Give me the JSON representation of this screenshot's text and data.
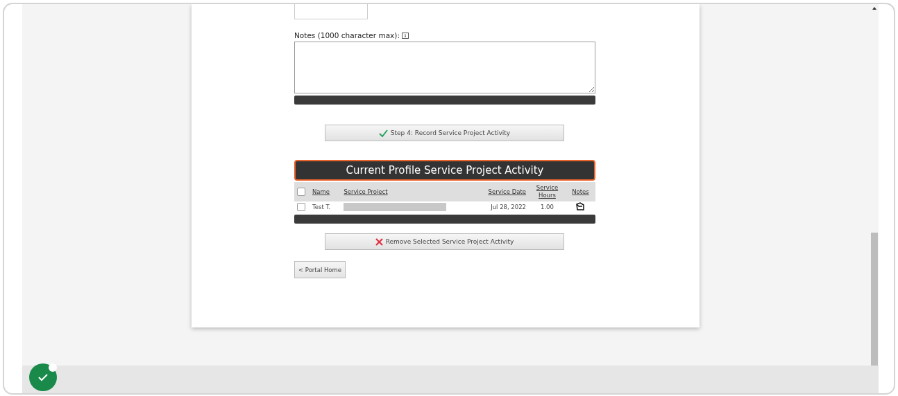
{
  "notes_field": {
    "label": "Notes (1000 character max):"
  },
  "record_button": {
    "label": "Step 4: Record Service Project Activity",
    "kind": "check"
  },
  "activity_table": {
    "title": "Current Profile Service Project Activity",
    "select_all": {
      "checked": false
    },
    "columns": [
      {
        "label": "Name"
      },
      {
        "label": "Service Project"
      },
      {
        "label": "Service Date"
      },
      {
        "label": "Service Hours"
      },
      {
        "label": "Notes"
      }
    ],
    "rows": [
      {
        "checked": false,
        "name": "Test T.",
        "redacted_project": true,
        "date": "Jul 28, 2022",
        "hours": "1.00"
      }
    ]
  },
  "remove_button": {
    "label": "Remove Selected Service Project Activity",
    "kind": "cross"
  },
  "home_button": {
    "label": "< Portal Home"
  }
}
